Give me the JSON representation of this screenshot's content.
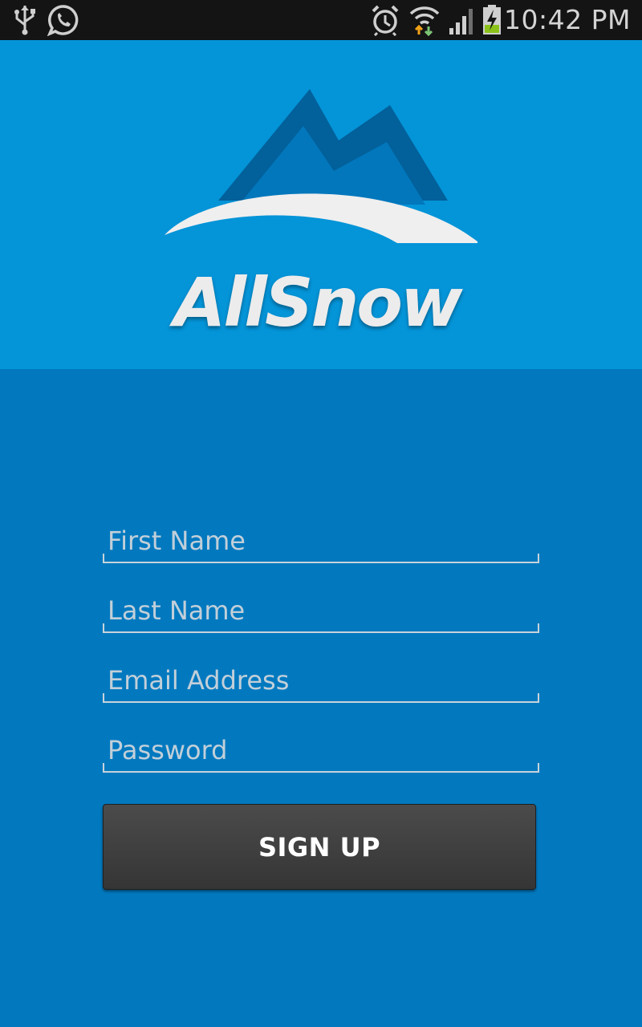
{
  "status_bar": {
    "time": "10:42 PM",
    "icons": [
      "usb-icon",
      "whatsapp-icon",
      "alarm-icon",
      "wifi-icon",
      "signal-icon",
      "battery-charging-icon"
    ]
  },
  "header": {
    "logo_text": "AllSnow"
  },
  "form": {
    "first_name": {
      "value": "",
      "placeholder": "First Name"
    },
    "last_name": {
      "value": "",
      "placeholder": "Last Name"
    },
    "email": {
      "value": "",
      "placeholder": "Email Address"
    },
    "password": {
      "value": "",
      "placeholder": "Password"
    },
    "signup_label": "SIGN UP"
  },
  "colors": {
    "status_bar": "#141414",
    "header_bg": "#0494d8",
    "body_bg": "#0279bf",
    "button_bg": "#404040",
    "mountain": "#02609a"
  }
}
